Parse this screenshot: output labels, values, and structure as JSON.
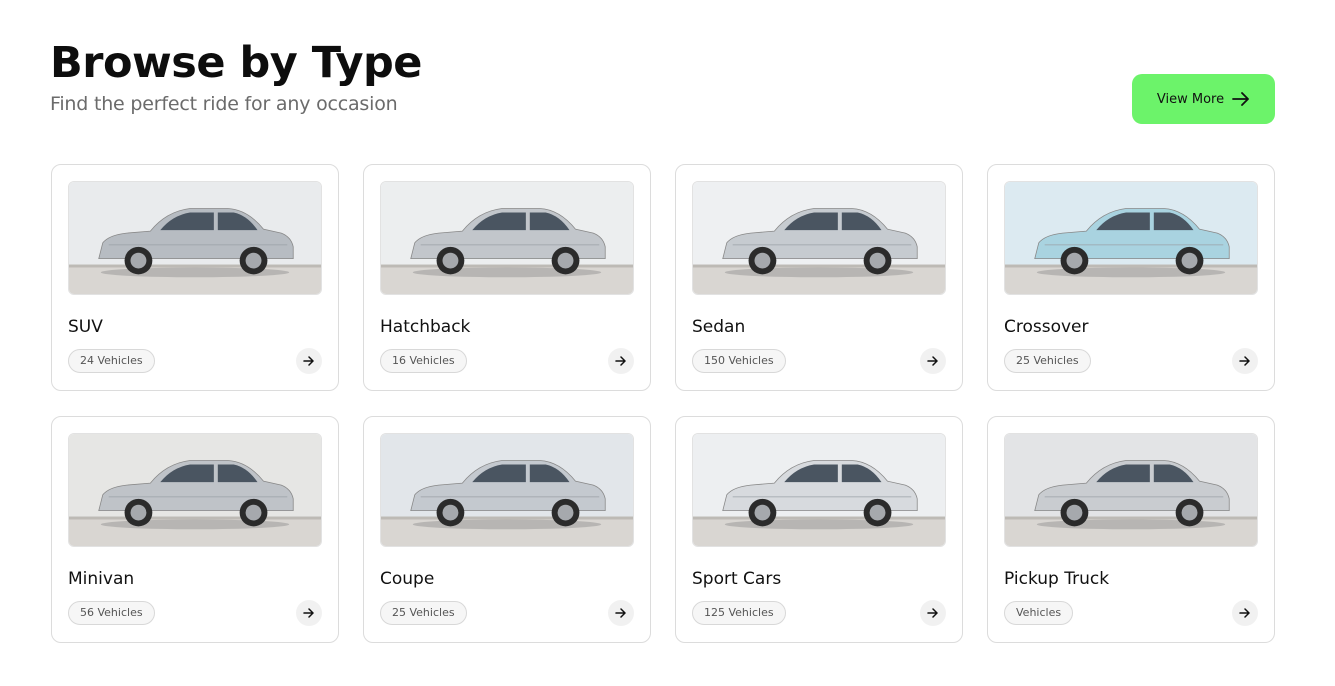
{
  "header": {
    "title": "Browse by Type",
    "subtitle": "Find the perfect ride for any occasion",
    "view_more_label": "View More"
  },
  "colors": {
    "accent": "#6cf36a"
  },
  "categories": [
    {
      "name": "SUV",
      "count": "24 Vehicles",
      "car_color": "#b7bcc2",
      "bg": "#e9ebed"
    },
    {
      "name": "Hatchback",
      "count": "16 Vehicles",
      "car_color": "#c2c6cb",
      "bg": "#eceeef"
    },
    {
      "name": "Sedan",
      "count": "150 Vehicles",
      "car_color": "#c6cbd0",
      "bg": "#eef0f2"
    },
    {
      "name": "Crossover",
      "count": "25 Vehicles",
      "car_color": "#a9d3e0",
      "bg": "#dceaf1"
    },
    {
      "name": "Minivan",
      "count": "56 Vehicles",
      "car_color": "#bfc3c8",
      "bg": "#e6e6e4"
    },
    {
      "name": "Coupe",
      "count": "25 Vehicles",
      "car_color": "#c4c9cf",
      "bg": "#e2e6ea"
    },
    {
      "name": "Sport Cars",
      "count": "125 Vehicles",
      "car_color": "#d7dade",
      "bg": "#edeff1"
    },
    {
      "name": "Pickup Truck",
      "count": "Vehicles",
      "car_color": "#c9ccd0",
      "bg": "#e3e4e6"
    }
  ]
}
